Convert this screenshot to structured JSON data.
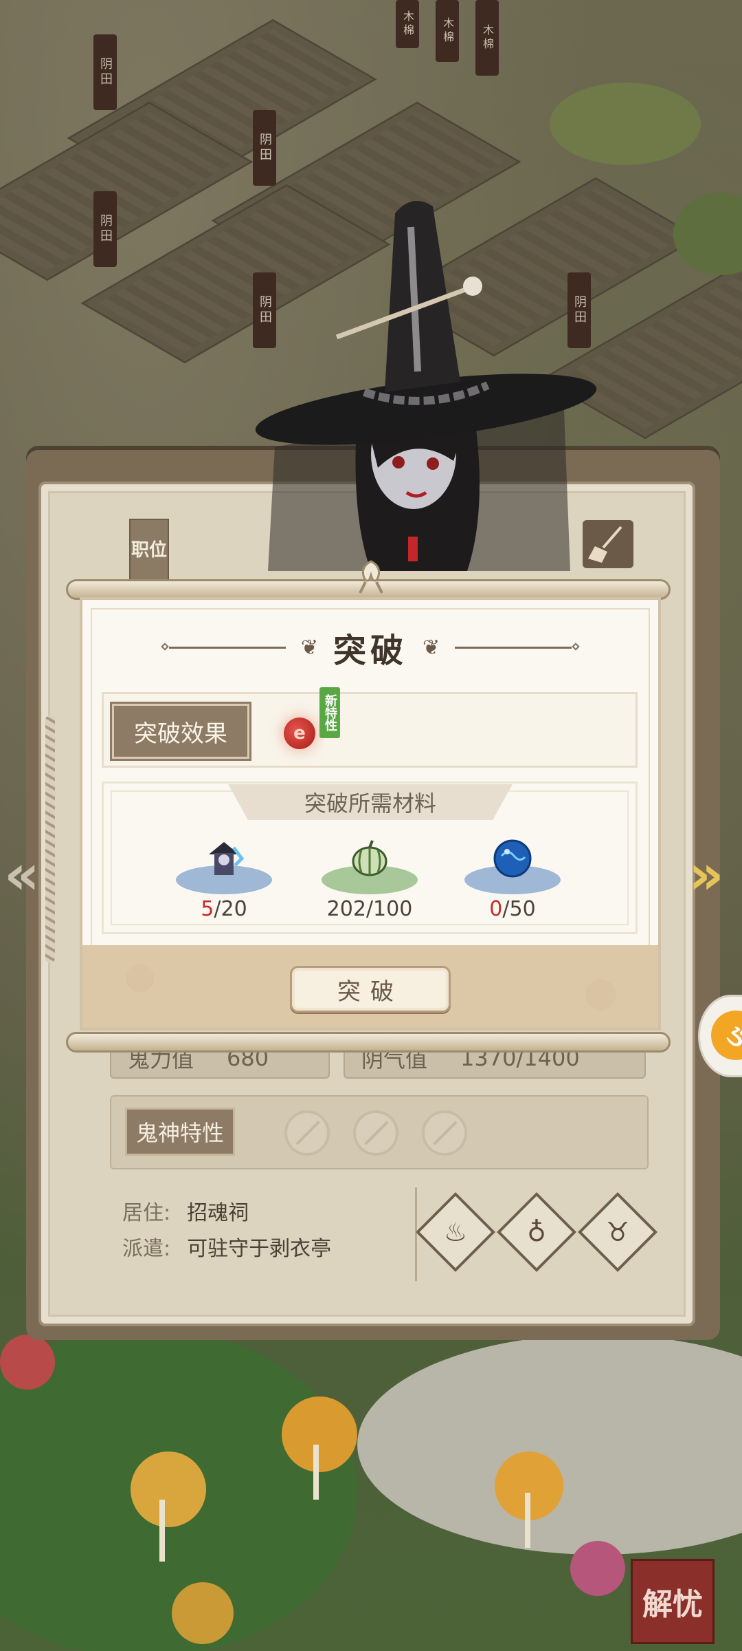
{
  "scene": {
    "field_signs": [
      "阴田",
      "阴田",
      "阴田",
      "阴田",
      "阴田"
    ],
    "top_signs": [
      "木棉",
      "木棉",
      "木棉"
    ]
  },
  "character_panel": {
    "position_tag": "职位",
    "stats": [
      {
        "label": "鬼力值",
        "value": "680"
      },
      {
        "label": "阴气值",
        "value": "1370/1400"
      }
    ],
    "trait_label": "鬼神特性",
    "residence_label": "居住:",
    "residence_value": "招魂祠",
    "dispatch_label": "派遣:",
    "dispatch_value": "可驻守于剥衣亭",
    "action_icons": [
      "incense-icon",
      "flame-icon",
      "pot-icon"
    ]
  },
  "dialog": {
    "title": "突破",
    "effect_label": "突破效果",
    "new_trait_tag": "新特性",
    "materials_header": "突破所需材料",
    "materials": [
      {
        "name": "ghost-portrait-icon",
        "current": "5",
        "required": "20",
        "insufficient": true,
        "plate_color": "#9fb8d6"
      },
      {
        "name": "melon-icon",
        "current": "202",
        "required": "100",
        "insufficient": false,
        "plate_color": "#a9c89a"
      },
      {
        "name": "blue-orb-icon",
        "current": "0",
        "required": "50",
        "insufficient": true,
        "plate_color": "#9fb8d6"
      }
    ],
    "button_label": "突破"
  },
  "seal_text": "解忧"
}
